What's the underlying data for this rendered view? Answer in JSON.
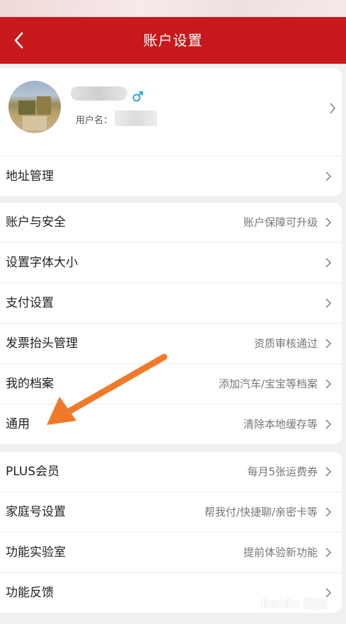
{
  "header": {
    "title": "账户设置",
    "back_icon": "chevron-left-icon",
    "bg_color": "#c8191c"
  },
  "profile": {
    "username_label": "用户名：",
    "gender_icon": "male-icon"
  },
  "address": {
    "label": "地址管理"
  },
  "group1": [
    {
      "label": "账户与安全",
      "value": "账户保障可升级"
    },
    {
      "label": "设置字体大小",
      "value": ""
    },
    {
      "label": "支付设置",
      "value": ""
    },
    {
      "label": "发票抬头管理",
      "value": "资质审核通过"
    },
    {
      "label": "我的档案",
      "value": "添加汽车/宝宝等档案"
    },
    {
      "label": "通用",
      "value": "清除本地缓存等"
    }
  ],
  "group2": [
    {
      "label": "PLUS会员",
      "value": "每月5张运费券"
    },
    {
      "label": "家庭号设置",
      "value": "帮我付/快捷聊/亲密卡等"
    },
    {
      "label": "功能实验室",
      "value": "提前体验新功能"
    },
    {
      "label": "功能反馈",
      "value": ""
    }
  ],
  "annotation": {
    "arrow_color": "#f07a2a"
  },
  "watermark": "Baidu 经验"
}
